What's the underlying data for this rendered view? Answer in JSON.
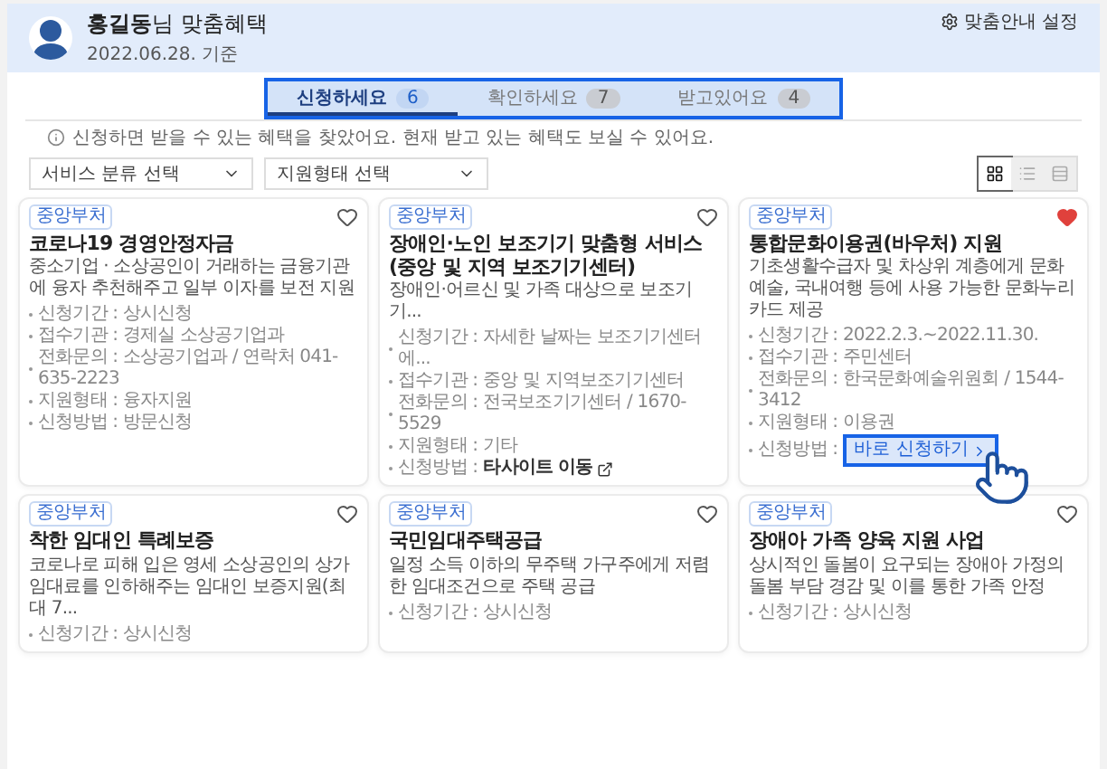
{
  "header": {
    "title_bold": "홍길동",
    "title_rest": "님 맞춤혜택",
    "date": "2022.06.28. 기준",
    "settings": "맞춤안내 설정"
  },
  "tabs": [
    {
      "label": "신청하세요",
      "count": "6",
      "selected": true
    },
    {
      "label": "확인하세요",
      "count": "7",
      "selected": false
    },
    {
      "label": "받고있어요",
      "count": "4",
      "selected": false
    }
  ],
  "info": "신청하면 받을 수 있는 혜택을 찾았어요. 현재 받고 있는 혜택도 보실 수 있어요.",
  "filters": [
    {
      "label": "서비스 분류 선택"
    },
    {
      "label": "지원형태 선택"
    }
  ],
  "view_toggles": [
    {
      "kind": "grid",
      "selected": true
    },
    {
      "kind": "list",
      "selected": false
    },
    {
      "kind": "detail",
      "selected": false
    }
  ],
  "cards": [
    {
      "tag": "중앙부처",
      "liked": false,
      "title": "코로나19 경영안정자금",
      "desc": "중소기업 · 소상공인이 거래하는 금융기관에 융자 추천해주고 일부 이자를 보전 지원",
      "details": [
        {
          "label": "신청기간 : ",
          "value": "상시신청"
        },
        {
          "label": "접수기관 : ",
          "value": "경제실 소상공기업과"
        },
        {
          "label": "전화문의 : ",
          "value": "소상공기업과 / 연락처 041-635-2223"
        },
        {
          "label": "지원형태 : ",
          "value": "융자지원"
        },
        {
          "label": "신청방법 : ",
          "value": "방문신청"
        }
      ]
    },
    {
      "tag": "중앙부처",
      "liked": false,
      "title": "장애인·노인 보조기기 맞춤형 서비스 (중앙 및 지역 보조기기센터)",
      "desc": "장애인·어르신 및 가족 대상으로 보조기기...",
      "details": [
        {
          "label": "신청기간 : ",
          "value": "자세한 날짜는 보조기기센터에..."
        },
        {
          "label": "접수기관 : ",
          "value": "중앙 및 지역보조기기센터"
        },
        {
          "label": "전화문의 : ",
          "value": "전국보조기기센터 / 1670-5529"
        },
        {
          "label": "지원형태 : ",
          "value": "기타"
        },
        {
          "label": "신청방법 :",
          "value": "타사이트 이동",
          "kind": "link"
        }
      ]
    },
    {
      "tag": "중앙부처",
      "liked": true,
      "title": "통합문화이용권(바우처) 지원",
      "desc": "기초생활수급자 및 차상위 계층에게 문화예술, 국내여행 등에 사용 가능한 문화누리카드 제공",
      "details": [
        {
          "label": "신청기간 : ",
          "value": "2022.2.3.~2022.11.30."
        },
        {
          "label": "접수기관 : ",
          "value": "주민센터"
        },
        {
          "label": "전화문의 : ",
          "value": "한국문화예술위원회 / 1544-3412"
        },
        {
          "label": "지원형태 : ",
          "value": "이용권"
        },
        {
          "label": "신청방법 :",
          "value": "바로 신청하기",
          "kind": "button"
        }
      ]
    },
    {
      "tag": "중앙부처",
      "liked": false,
      "title": "착한 임대인 특례보증",
      "desc": "코로나로 피해 입은 영세 소상공인의 상가 임대료를 인하해주는 임대인 보증지원(최대 7...",
      "details": [
        {
          "label": "신청기간 : ",
          "value": "상시신청"
        }
      ]
    },
    {
      "tag": "중앙부처",
      "liked": false,
      "title": "국민임대주택공급",
      "desc": "일정 소득 이하의 무주택 가구주에게 저렴한 임대조건으로 주택 공급",
      "details": [
        {
          "label": "신청기간 : ",
          "value": "상시신청"
        }
      ]
    },
    {
      "tag": "중앙부처",
      "liked": false,
      "title": "장애아 가족 양육 지원 사업",
      "desc": "상시적인 돌봄이 요구되는 장애아 가정의 돌봄 부담 경감 및 이를 통한 가족 안정",
      "details": [
        {
          "label": "신청기간 : ",
          "value": "상시신청"
        }
      ]
    }
  ]
}
